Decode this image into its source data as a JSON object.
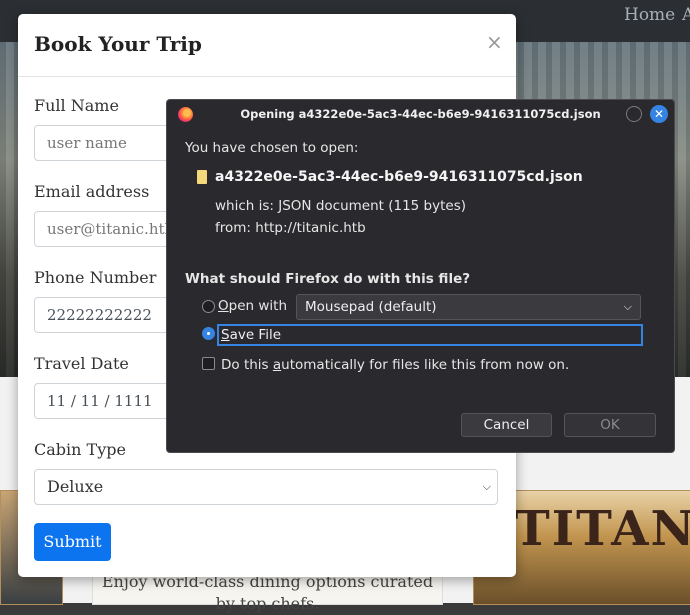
{
  "page": {
    "nav_links": [
      "Home",
      "A"
    ],
    "card_text": "Enjoy world-class dining options curated by top chefs.",
    "poster_word": "TITAN"
  },
  "modal": {
    "title": "Book Your Trip",
    "close_glyph": "×",
    "fields": [
      {
        "label": "Full Name",
        "value": "user name"
      },
      {
        "label": "Email address",
        "value": "user@titanic.htb"
      },
      {
        "label": "Phone Number",
        "value": "22222222222"
      },
      {
        "label": "Travel Date",
        "value": "11 / 11 / 1111"
      },
      {
        "label": "Cabin Type",
        "value": "Deluxe"
      }
    ],
    "submit_label": "Submit"
  },
  "dialog": {
    "title": "Opening a4322e0e-5ac3-44ec-b6e9-9416311075cd.json",
    "intro": "You have chosen to open:",
    "file_name": "a4322e0e-5ac3-44ec-b6e9-9416311075cd.json",
    "which_is_label": "which is:",
    "which_is_value": "JSON document (115 bytes)",
    "from_label": "from:",
    "from_value": "http://titanic.htb",
    "question": "What should Firefox do with this file?",
    "open_with_label": "Open with",
    "open_with_app": "Mousepad (default)",
    "save_file_label": "Save File",
    "auto_label": "Do this automatically for files like this from now on.",
    "cancel_label": "Cancel",
    "ok_label": "OK",
    "selected_option": "Save File",
    "auto_checked": false
  },
  "colors": {
    "accent": "#3584e4",
    "submit_bg": "#0d74f0",
    "dialog_bg": "#2a2a2e"
  }
}
